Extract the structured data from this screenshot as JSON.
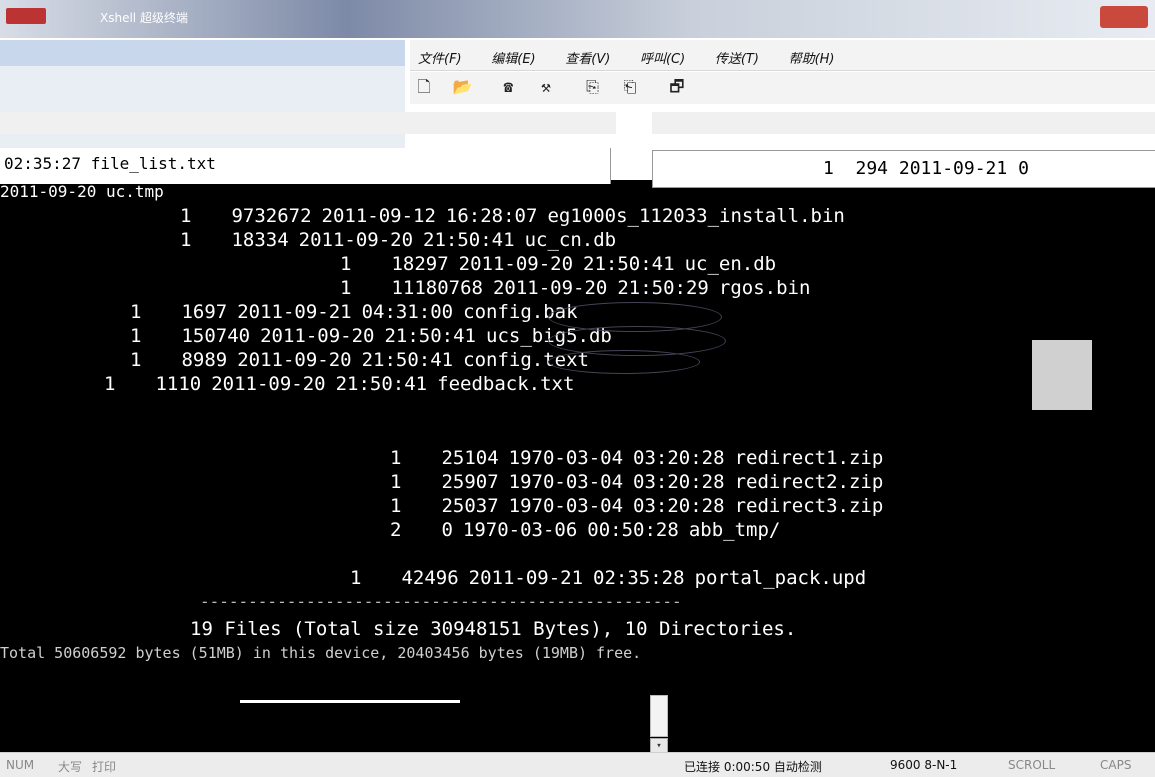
{
  "window": {
    "title": "Xshell 超级终端"
  },
  "menu": [
    "文件(F)",
    "编辑(E)",
    "查看(V)",
    "呼叫(C)",
    "传送(T)",
    "帮助(H)"
  ],
  "toolbar_icons": [
    "new-doc-icon",
    "open-folder-icon",
    "disconnect-icon",
    "call-icon",
    "send-icon",
    "receive-icon",
    "properties-icon"
  ],
  "top_fragments": {
    "left_time": "02:35:27 file_list.txt",
    "left_prev": "2011-09-20 uc.tmp",
    "right_row": "1  294 2011-09-21 0"
  },
  "listing": [
    {
      "count": "1",
      "size": "9732672",
      "date": "2011-09-12",
      "time": "16:28:07",
      "name": "eg1000s_112033_install.bin"
    },
    {
      "count": "1",
      "size": "18334",
      "date": "2011-09-20",
      "time": "21:50:41",
      "name": "uc_cn.db"
    },
    {
      "count": "1",
      "size": "18297",
      "date": "2011-09-20",
      "time": "21:50:41",
      "name": "uc_en.db"
    },
    {
      "count": "1",
      "size": "11180768",
      "date": "2011-09-20",
      "time": "21:50:29",
      "name": "rgos.bin"
    },
    {
      "count": "1",
      "size": "1697",
      "date": "2011-09-21",
      "time": "04:31:00",
      "name": "config.bak"
    },
    {
      "count": "1",
      "size": "150740",
      "date": "2011-09-20",
      "time": "21:50:41",
      "name": "ucs_big5.db"
    },
    {
      "count": "1",
      "size": "8989",
      "date": "2011-09-20",
      "time": "21:50:41",
      "name": "config.text"
    },
    {
      "count": "1",
      "size": "1110",
      "date": "2011-09-20",
      "time": "21:50:41",
      "name": "feedback.txt"
    },
    {
      "count": "1",
      "size": "25104",
      "date": "1970-03-04",
      "time": "03:20:28",
      "name": "redirect1.zip"
    },
    {
      "count": "1",
      "size": "25907",
      "date": "1970-03-04",
      "time": "03:20:28",
      "name": "redirect2.zip"
    },
    {
      "count": "1",
      "size": "25037",
      "date": "1970-03-04",
      "time": "03:20:28",
      "name": "redirect3.zip"
    },
    {
      "count": "2",
      "size": "0",
      "date": "1970-03-06",
      "time": "00:50:28",
      "name": "abb_tmp/"
    },
    {
      "count": "1",
      "size": "42496",
      "date": "2011-09-21",
      "time": "02:35:28",
      "name": "portal_pack.upd"
    }
  ],
  "separator": "--------------------------------------------------",
  "summary": "19 Files (Total size 30948151 Bytes), 10 Directories.",
  "summary2": "Total 50606592 bytes (51MB) in this device, 20403456 bytes (19MB) free.",
  "status": {
    "num": "NUM",
    "caps_lock_cn": "大写",
    "print": "打印",
    "connected": "已连接 0:00:50 自动检测",
    "baud": "9600 8-N-1",
    "scroll": "SCROLL",
    "caps": "CAPS"
  }
}
